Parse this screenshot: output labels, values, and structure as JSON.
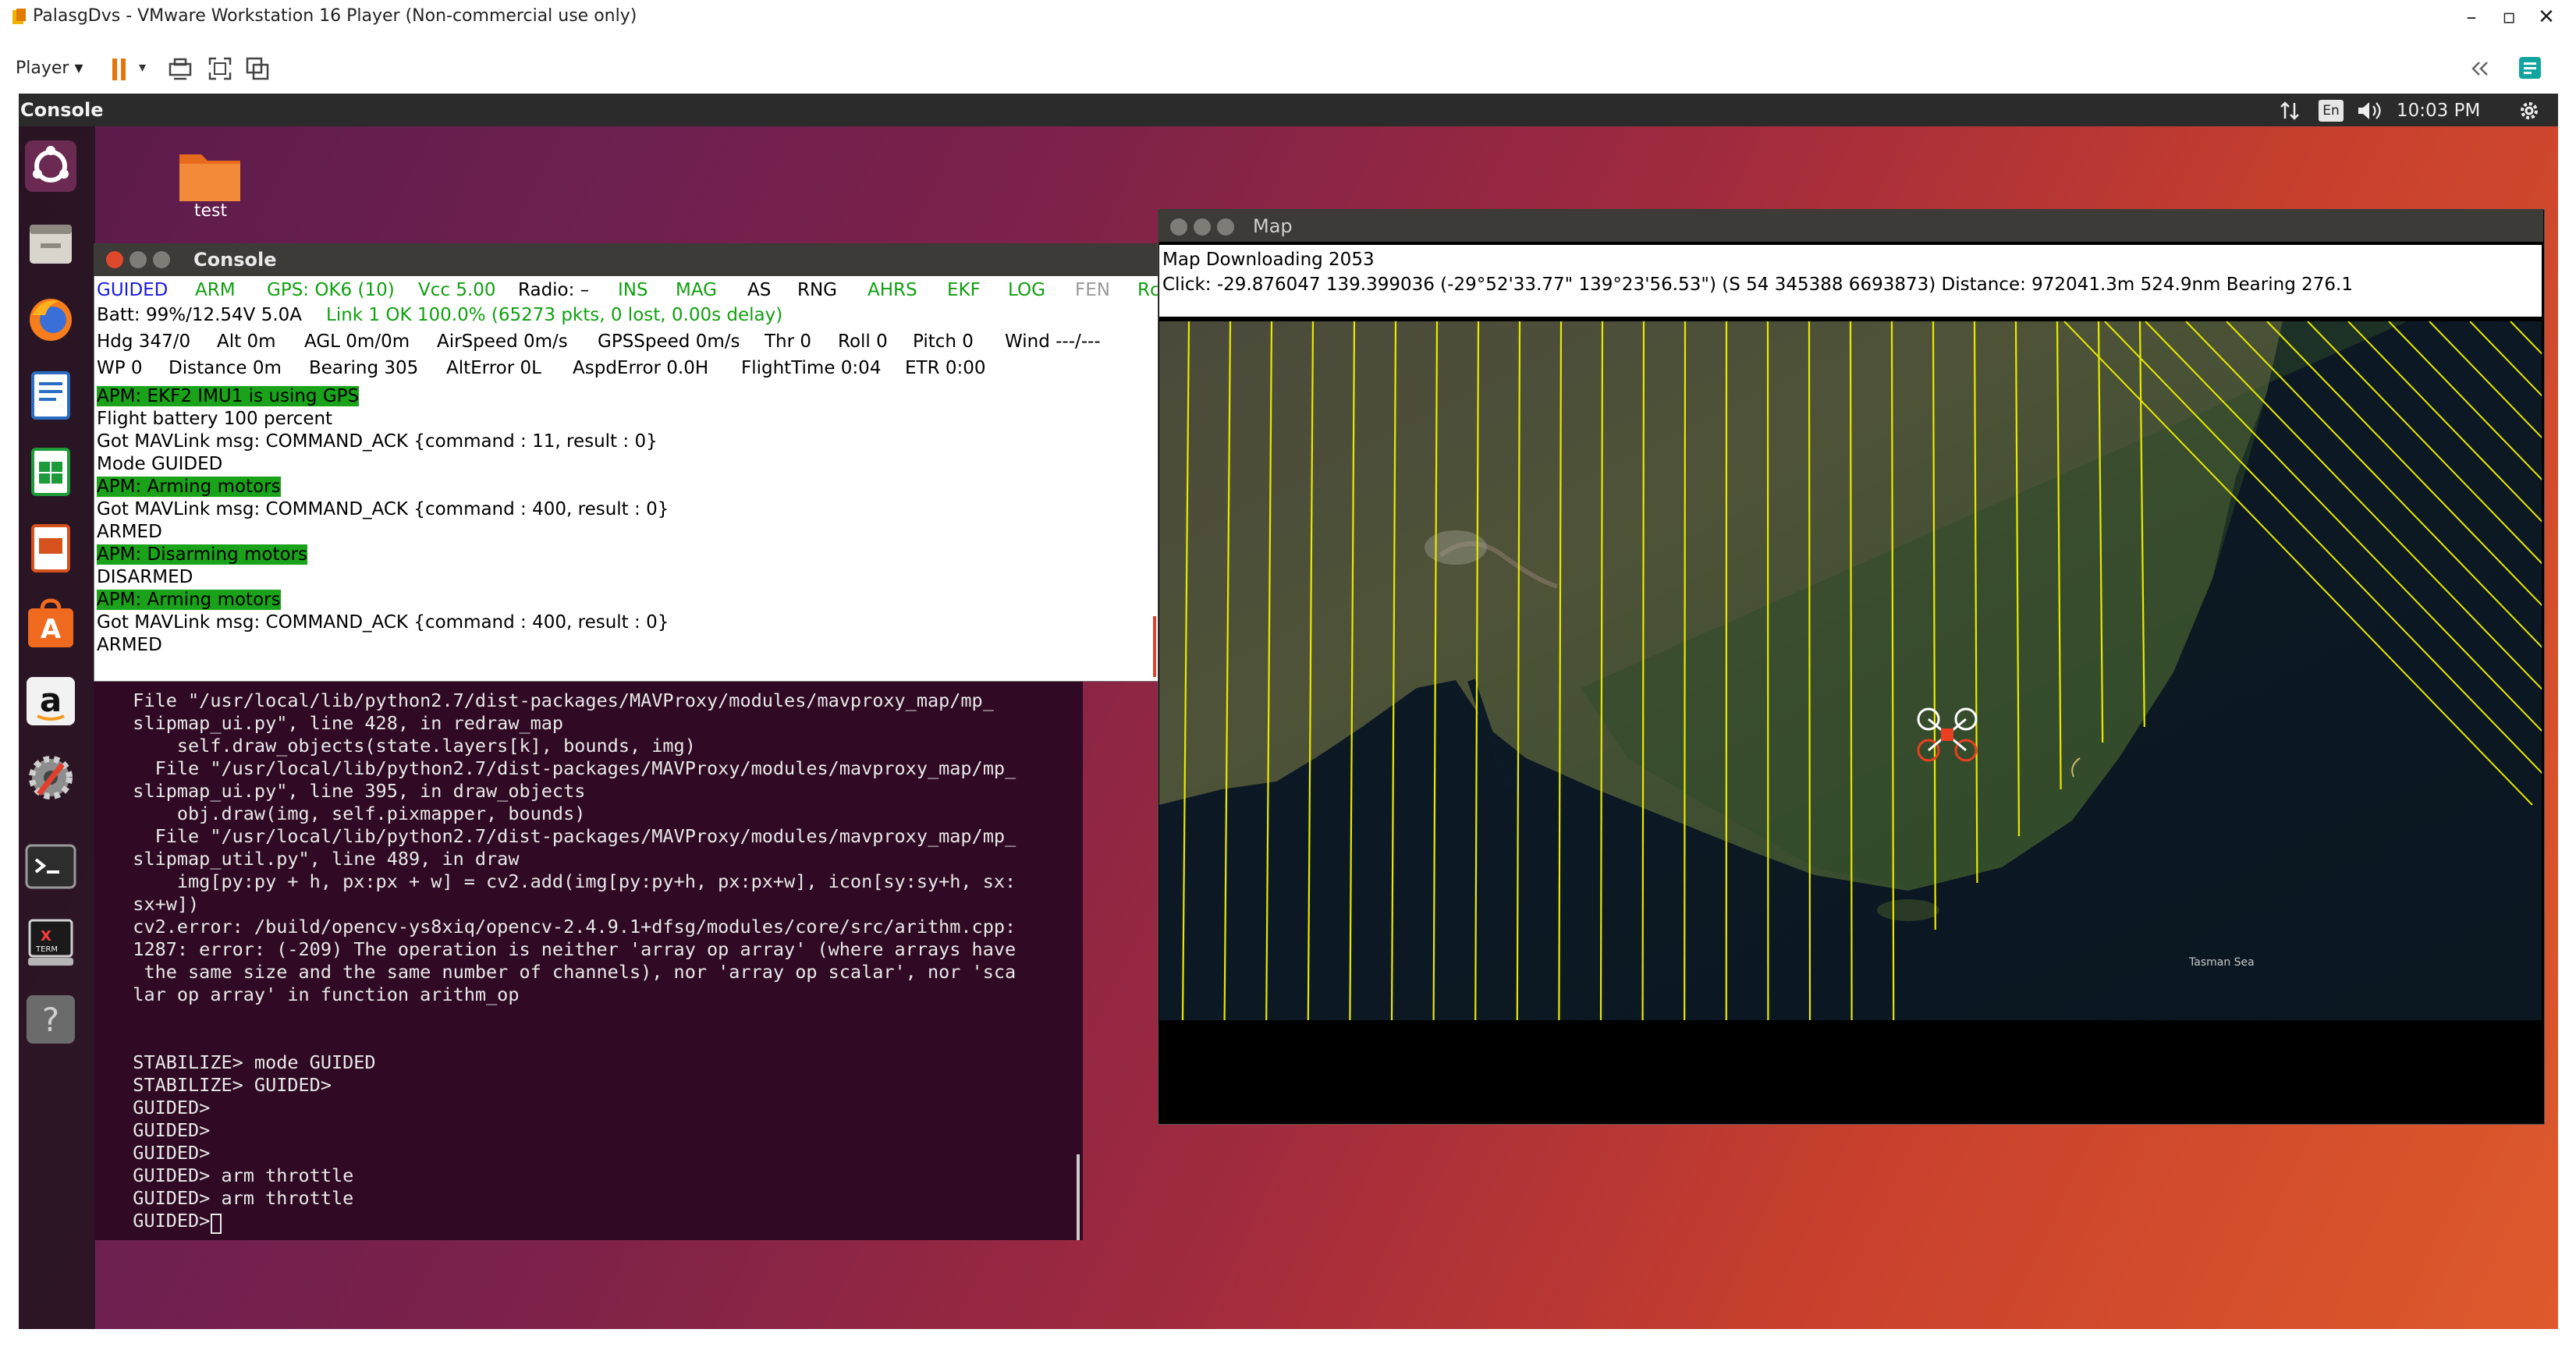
{
  "vmware": {
    "window_title": "PalasgDvs - VMware Workstation 16 Player (Non-commercial use only)",
    "minimize_glyph": "–",
    "maximize_glyph": "▫",
    "close_glyph": "✕",
    "player_menu": "Player ▾",
    "console_tab": "Console"
  },
  "tray": {
    "lang": "En",
    "clock": "10:03 PM"
  },
  "desktop": {
    "folder_label": "test"
  },
  "console_window": {
    "title": "Console",
    "status_rows": [
      [
        {
          "text": "GUIDED",
          "color": "#1a1ae0"
        },
        {
          "text": "ARM",
          "color": "#10a010"
        },
        {
          "text": "GPS: OK6 (10)",
          "color": "#10a010"
        },
        {
          "text": "Vcc 5.00",
          "color": "#10a010"
        },
        {
          "text": "Radio: –",
          "color": "#000000"
        },
        {
          "text": "INS",
          "color": "#10a010"
        },
        {
          "text": "MAG",
          "color": "#10a010"
        },
        {
          "text": "AS",
          "color": "#000000"
        },
        {
          "text": "RNG",
          "color": "#000000"
        },
        {
          "text": "AHRS",
          "color": "#10a010"
        },
        {
          "text": "EKF",
          "color": "#10a010"
        },
        {
          "text": "LOG",
          "color": "#10a010"
        },
        {
          "text": "FEN",
          "color": "#9a9a9a"
        },
        {
          "text": "Rc",
          "color": "#10a010"
        }
      ],
      [
        {
          "text": "Batt: 99%/12.54V 5.0A",
          "color": "#000000"
        },
        {
          "text": "Link 1 OK 100.0% (65273 pkts, 0 lost, 0.00s delay)",
          "color": "#10a010"
        }
      ],
      [
        {
          "text": "Hdg 347/0",
          "color": "#000000"
        },
        {
          "text": "Alt 0m",
          "color": "#000000"
        },
        {
          "text": "AGL 0m/0m",
          "color": "#000000"
        },
        {
          "text": "AirSpeed 0m/s",
          "color": "#000000"
        },
        {
          "text": "GPSSpeed 0m/s",
          "color": "#000000"
        },
        {
          "text": "Thr 0",
          "color": "#000000"
        },
        {
          "text": "Roll 0",
          "color": "#000000"
        },
        {
          "text": "Pitch 0",
          "color": "#000000"
        },
        {
          "text": "Wind ---/---",
          "color": "#000000"
        }
      ],
      [
        {
          "text": "WP 0",
          "color": "#000000"
        },
        {
          "text": "Distance 0m",
          "color": "#000000"
        },
        {
          "text": "Bearing 305",
          "color": "#000000"
        },
        {
          "text": "AltError 0L",
          "color": "#000000"
        },
        {
          "text": "AspdError 0.0H",
          "color": "#000000"
        },
        {
          "text": "FlightTime 0:04",
          "color": "#000000"
        },
        {
          "text": "ETR 0:00",
          "color": "#000000"
        }
      ]
    ],
    "log_lines": [
      {
        "text": "APM: EKF2 IMU1 is using GPS",
        "highlight": true
      },
      {
        "text": "Flight battery 100 percent",
        "highlight": false
      },
      {
        "text": "Got MAVLink msg: COMMAND_ACK {command : 11, result : 0}",
        "highlight": false
      },
      {
        "text": "Mode GUIDED",
        "highlight": false
      },
      {
        "text": "APM: Arming motors",
        "highlight": true
      },
      {
        "text": "Got MAVLink msg: COMMAND_ACK {command : 400, result : 0}",
        "highlight": false
      },
      {
        "text": "ARMED",
        "highlight": false
      },
      {
        "text": "APM: Disarming motors",
        "highlight": true
      },
      {
        "text": "DISARMED",
        "highlight": false
      },
      {
        "text": "APM: Arming motors",
        "highlight": true
      },
      {
        "text": "Got MAVLink msg: COMMAND_ACK {command : 400, result : 0}",
        "highlight": false
      },
      {
        "text": "ARMED",
        "highlight": false
      }
    ]
  },
  "terminal": {
    "text": "  File \"/usr/local/lib/python2.7/dist-packages/MAVProxy/modules/mavproxy_map/mp_\n  slipmap_ui.py\", line 428, in redraw_map\n      self.draw_objects(state.layers[k], bounds, img)\n    File \"/usr/local/lib/python2.7/dist-packages/MAVProxy/modules/mavproxy_map/mp_\n  slipmap_ui.py\", line 395, in draw_objects\n      obj.draw(img, self.pixmapper, bounds)\n    File \"/usr/local/lib/python2.7/dist-packages/MAVProxy/modules/mavproxy_map/mp_\n  slipmap_util.py\", line 489, in draw\n      img[py:py + h, px:px + w] = cv2.add(img[py:py+h, px:px+w], icon[sy:sy+h, sx:\n  sx+w])\n  cv2.error: /build/opencv-ys8xiq/opencv-2.4.9.1+dfsg/modules/core/src/arithm.cpp:\n  1287: error: (-209) The operation is neither 'array op array' (where arrays have\n   the same size and the same number of channels), nor 'array op scalar', nor 'sca\n  lar op array' in function arithm_op\n\n\n  STABILIZE> mode GUIDED\n  STABILIZE> GUIDED>\n  GUIDED>\n  GUIDED>\n  GUIDED>\n  GUIDED> arm throttle\n  GUIDED> arm throttle\n  GUIDED> "
  },
  "map_window": {
    "title": "Map",
    "info_line1": "Map Downloading 2053",
    "info_line2": "Click: -29.876047 139.399036 (-29°52'33.77\" 139°23'56.53\") (S 54 345388 6693873)  Distance: 972041.3m 524.9nm  Bearing 276.1",
    "sea_label": "Tasman Sea"
  },
  "colors": {
    "highlight": "#1aa31a",
    "map_lines": "#e8e800",
    "terminal_bg": "#300a24"
  }
}
